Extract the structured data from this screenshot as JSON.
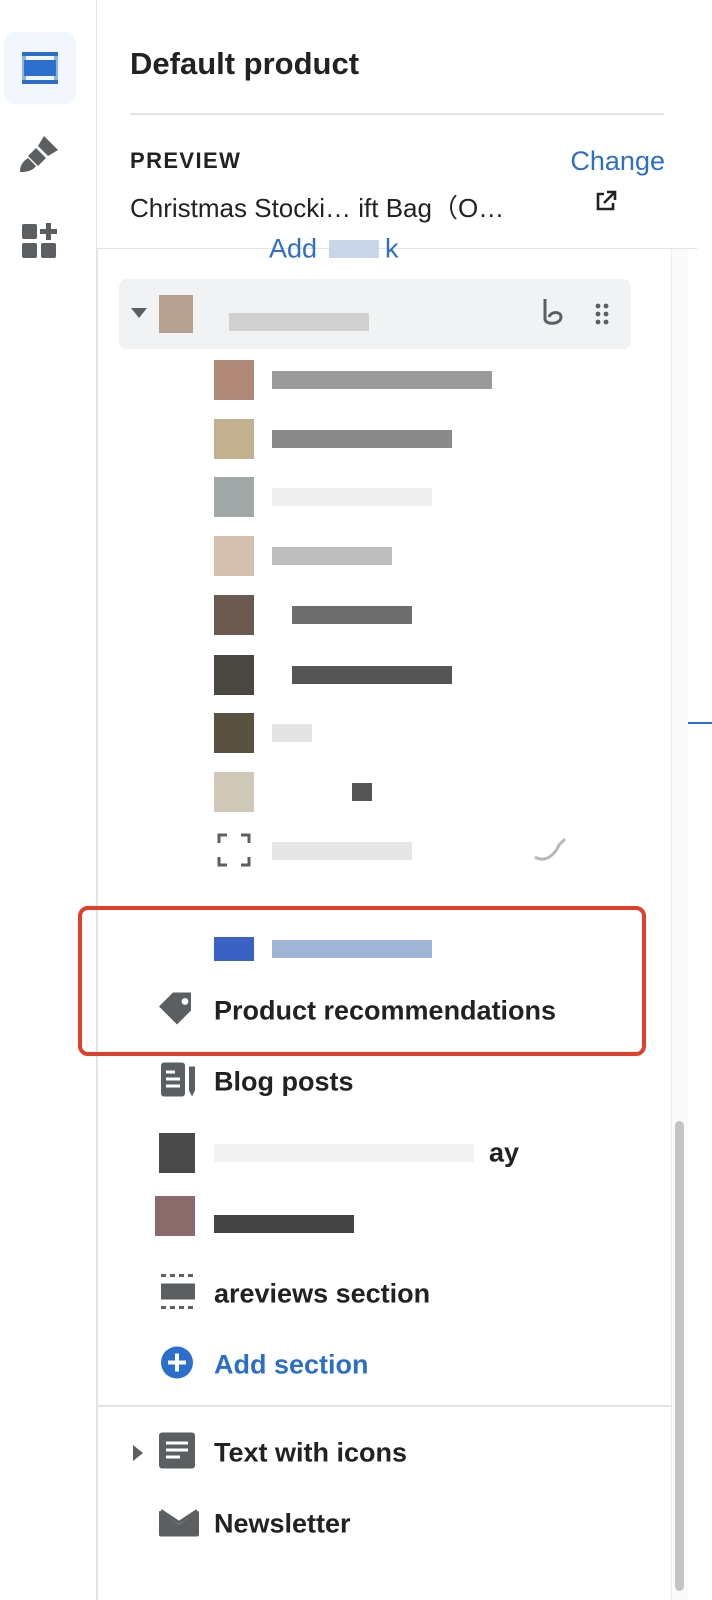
{
  "header": {
    "title": "Default product",
    "preview_label": "PREVIEW",
    "change_link": "Change",
    "preview_value": "Christmas Stocki… ift Bag（O…"
  },
  "rail": {
    "items": [
      {
        "icon": "sections-icon",
        "active": true
      },
      {
        "icon": "theme-settings-icon",
        "active": false
      },
      {
        "icon": "app-embeds-icon",
        "active": false
      }
    ]
  },
  "tree": {
    "partial_link": "Add",
    "partial_link_tail": "k",
    "rows": [
      {
        "label": "Product recommendations",
        "icon": "tag-icon"
      },
      {
        "label": "Blog posts",
        "icon": "blog-icon"
      },
      {
        "label": "ay",
        "icon": "thumbnail"
      },
      {
        "label": "areviews section",
        "icon": "section-icon"
      },
      {
        "label": "Add section",
        "icon": "plus-circle-icon"
      },
      {
        "label": "Text with icons",
        "icon": "text-icon"
      },
      {
        "label": "Newsletter",
        "icon": "envelope-icon"
      }
    ]
  },
  "colors": {
    "accent": "#2c6ecb",
    "highlight": "#e0402b",
    "text": "#202223",
    "icon": "#5c5f62"
  }
}
